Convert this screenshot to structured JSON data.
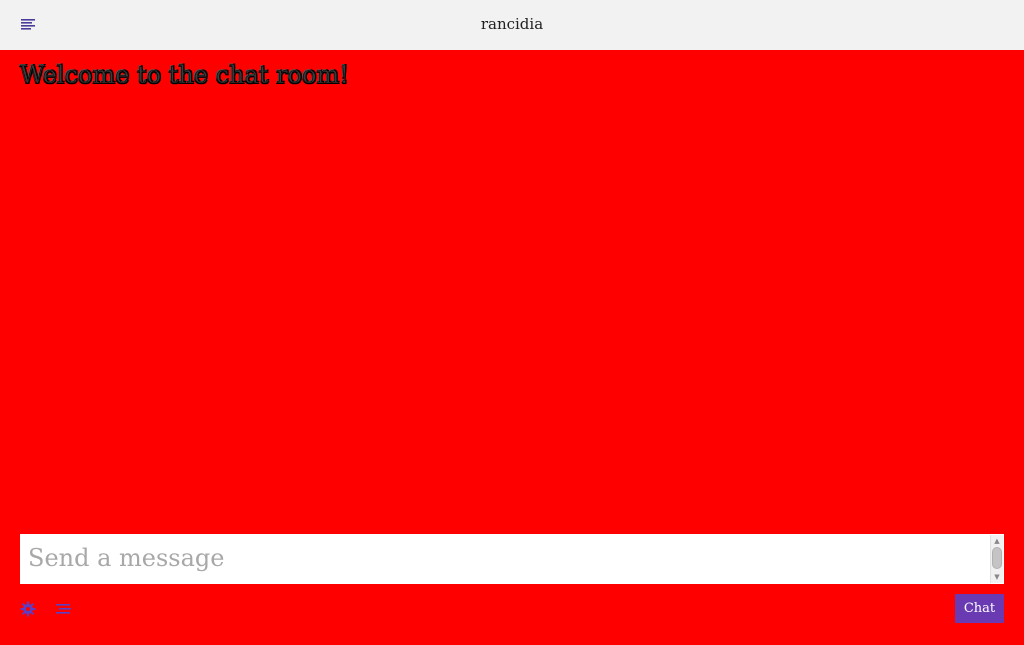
{
  "header": {
    "menu_icon": "menu-lines-icon",
    "room_name": "rancidia"
  },
  "chat_log": {
    "welcome_message": "Welcome to the chat room!"
  },
  "input": {
    "placeholder": "Send a message",
    "value": ""
  },
  "controls": {
    "settings_icon": "gear-icon",
    "user_list_icon": "user-list-icon",
    "send_label": "Chat"
  },
  "colors": {
    "background": "#ff0000",
    "header_background": "#f2f2f2",
    "accent": "#6a3ab2"
  }
}
